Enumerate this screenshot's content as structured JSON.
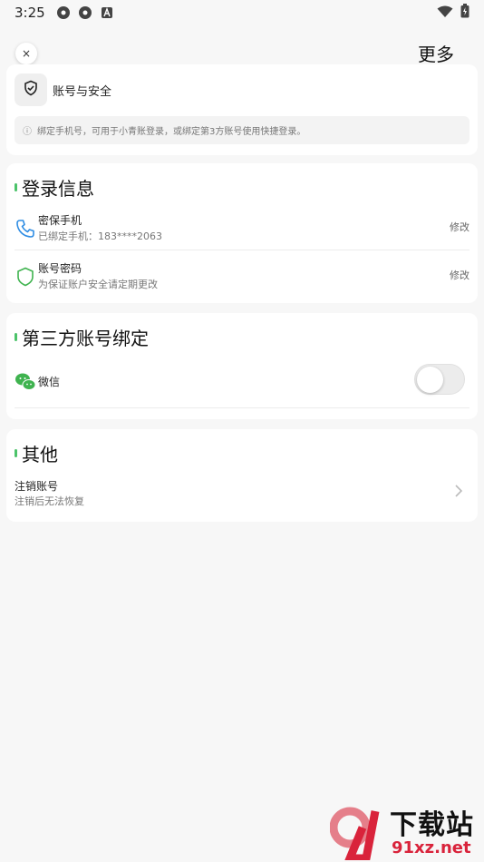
{
  "status_bar": {
    "time": "3:25"
  },
  "top_bar": {
    "close_label": "×",
    "more_label": "更多"
  },
  "account_card": {
    "title": "账号与安全",
    "tip": "绑定手机号，可用于小青账登录，或绑定第3方账号使用快捷登录。"
  },
  "login_info": {
    "section_title": "登录信息",
    "items": [
      {
        "title": "密保手机",
        "subtitle": "已绑定手机：183****2063",
        "action": "修改",
        "icon": "phone-icon"
      },
      {
        "title": "账号密码",
        "subtitle": "为保证账户安全请定期更改",
        "action": "修改",
        "icon": "shield-icon"
      }
    ]
  },
  "third_party": {
    "section_title": "第三方账号绑定",
    "items": [
      {
        "title": "微信",
        "icon": "wechat-icon",
        "bound": false
      }
    ]
  },
  "other": {
    "section_title": "其他",
    "items": [
      {
        "title": "注销账号",
        "subtitle": "注销后无法恢复",
        "icon": "chevron-right-icon"
      }
    ]
  },
  "watermark": {
    "brand": "下载站",
    "url": "91xz.net"
  },
  "colors": {
    "accent_green": "#4cc36a",
    "phone_blue": "#2f8de4",
    "wechat_green": "#3fb34f",
    "watermark_red": "#d9233b"
  }
}
